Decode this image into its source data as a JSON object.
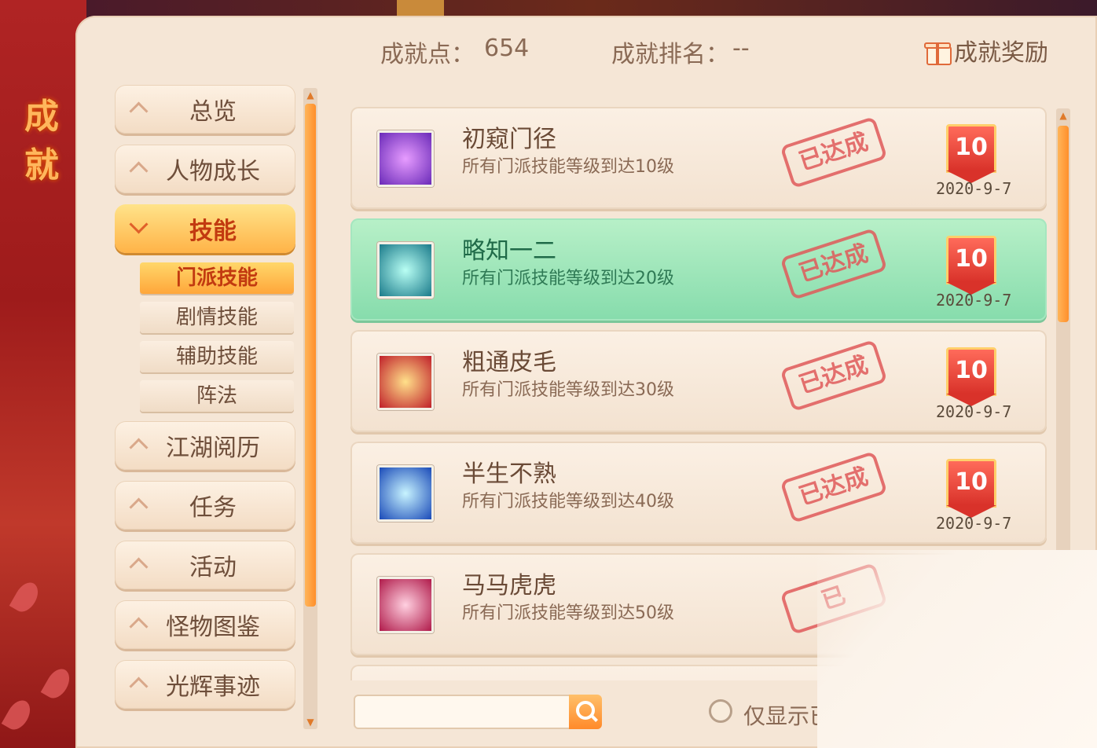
{
  "side_title": "成\n就",
  "header": {
    "points_label": "成就点：",
    "points_value": "654",
    "rank_label": "成就排名：",
    "rank_value": "--",
    "reward_label": "成就奖励"
  },
  "categories": [
    {
      "label": "总览",
      "expanded": false
    },
    {
      "label": "人物成长",
      "expanded": false
    },
    {
      "label": "技能",
      "expanded": true
    },
    {
      "label": "江湖阅历",
      "expanded": false
    },
    {
      "label": "任务",
      "expanded": false
    },
    {
      "label": "活动",
      "expanded": false
    },
    {
      "label": "怪物图鉴",
      "expanded": false
    },
    {
      "label": "光辉事迹",
      "expanded": false
    }
  ],
  "subcategories": [
    "门派技能",
    "剧情技能",
    "辅助技能",
    "阵法"
  ],
  "achievements": [
    {
      "name": "初窥门径",
      "desc": "所有门派技能等级到达10级",
      "stamp": "已达成",
      "points": "10",
      "date": "2020-9-7",
      "icon": "purple-skill-icon"
    },
    {
      "name": "略知一二",
      "desc": "所有门派技能等级到达20级",
      "stamp": "已达成",
      "points": "10",
      "date": "2020-9-7",
      "icon": "teal-meditation-icon"
    },
    {
      "name": "粗通皮毛",
      "desc": "所有门派技能等级到达30级",
      "stamp": "已达成",
      "points": "10",
      "date": "2020-9-7",
      "icon": "red-aura-icon"
    },
    {
      "name": "半生不熟",
      "desc": "所有门派技能等级到达40级",
      "stamp": "已达成",
      "points": "10",
      "date": "2020-9-7",
      "icon": "blue-figure-icon"
    },
    {
      "name": "马马虎虎",
      "desc": "所有门派技能等级到达50级",
      "stamp": "已",
      "points": "",
      "date": "",
      "icon": "pink-burst-icon"
    }
  ],
  "search": {
    "placeholder": "",
    "value": ""
  },
  "filter_label": "仅显示已",
  "colors": {
    "accent": "#ff9a3a",
    "stamp": "#e05a5a",
    "selected_row": "#9ee6bb"
  }
}
